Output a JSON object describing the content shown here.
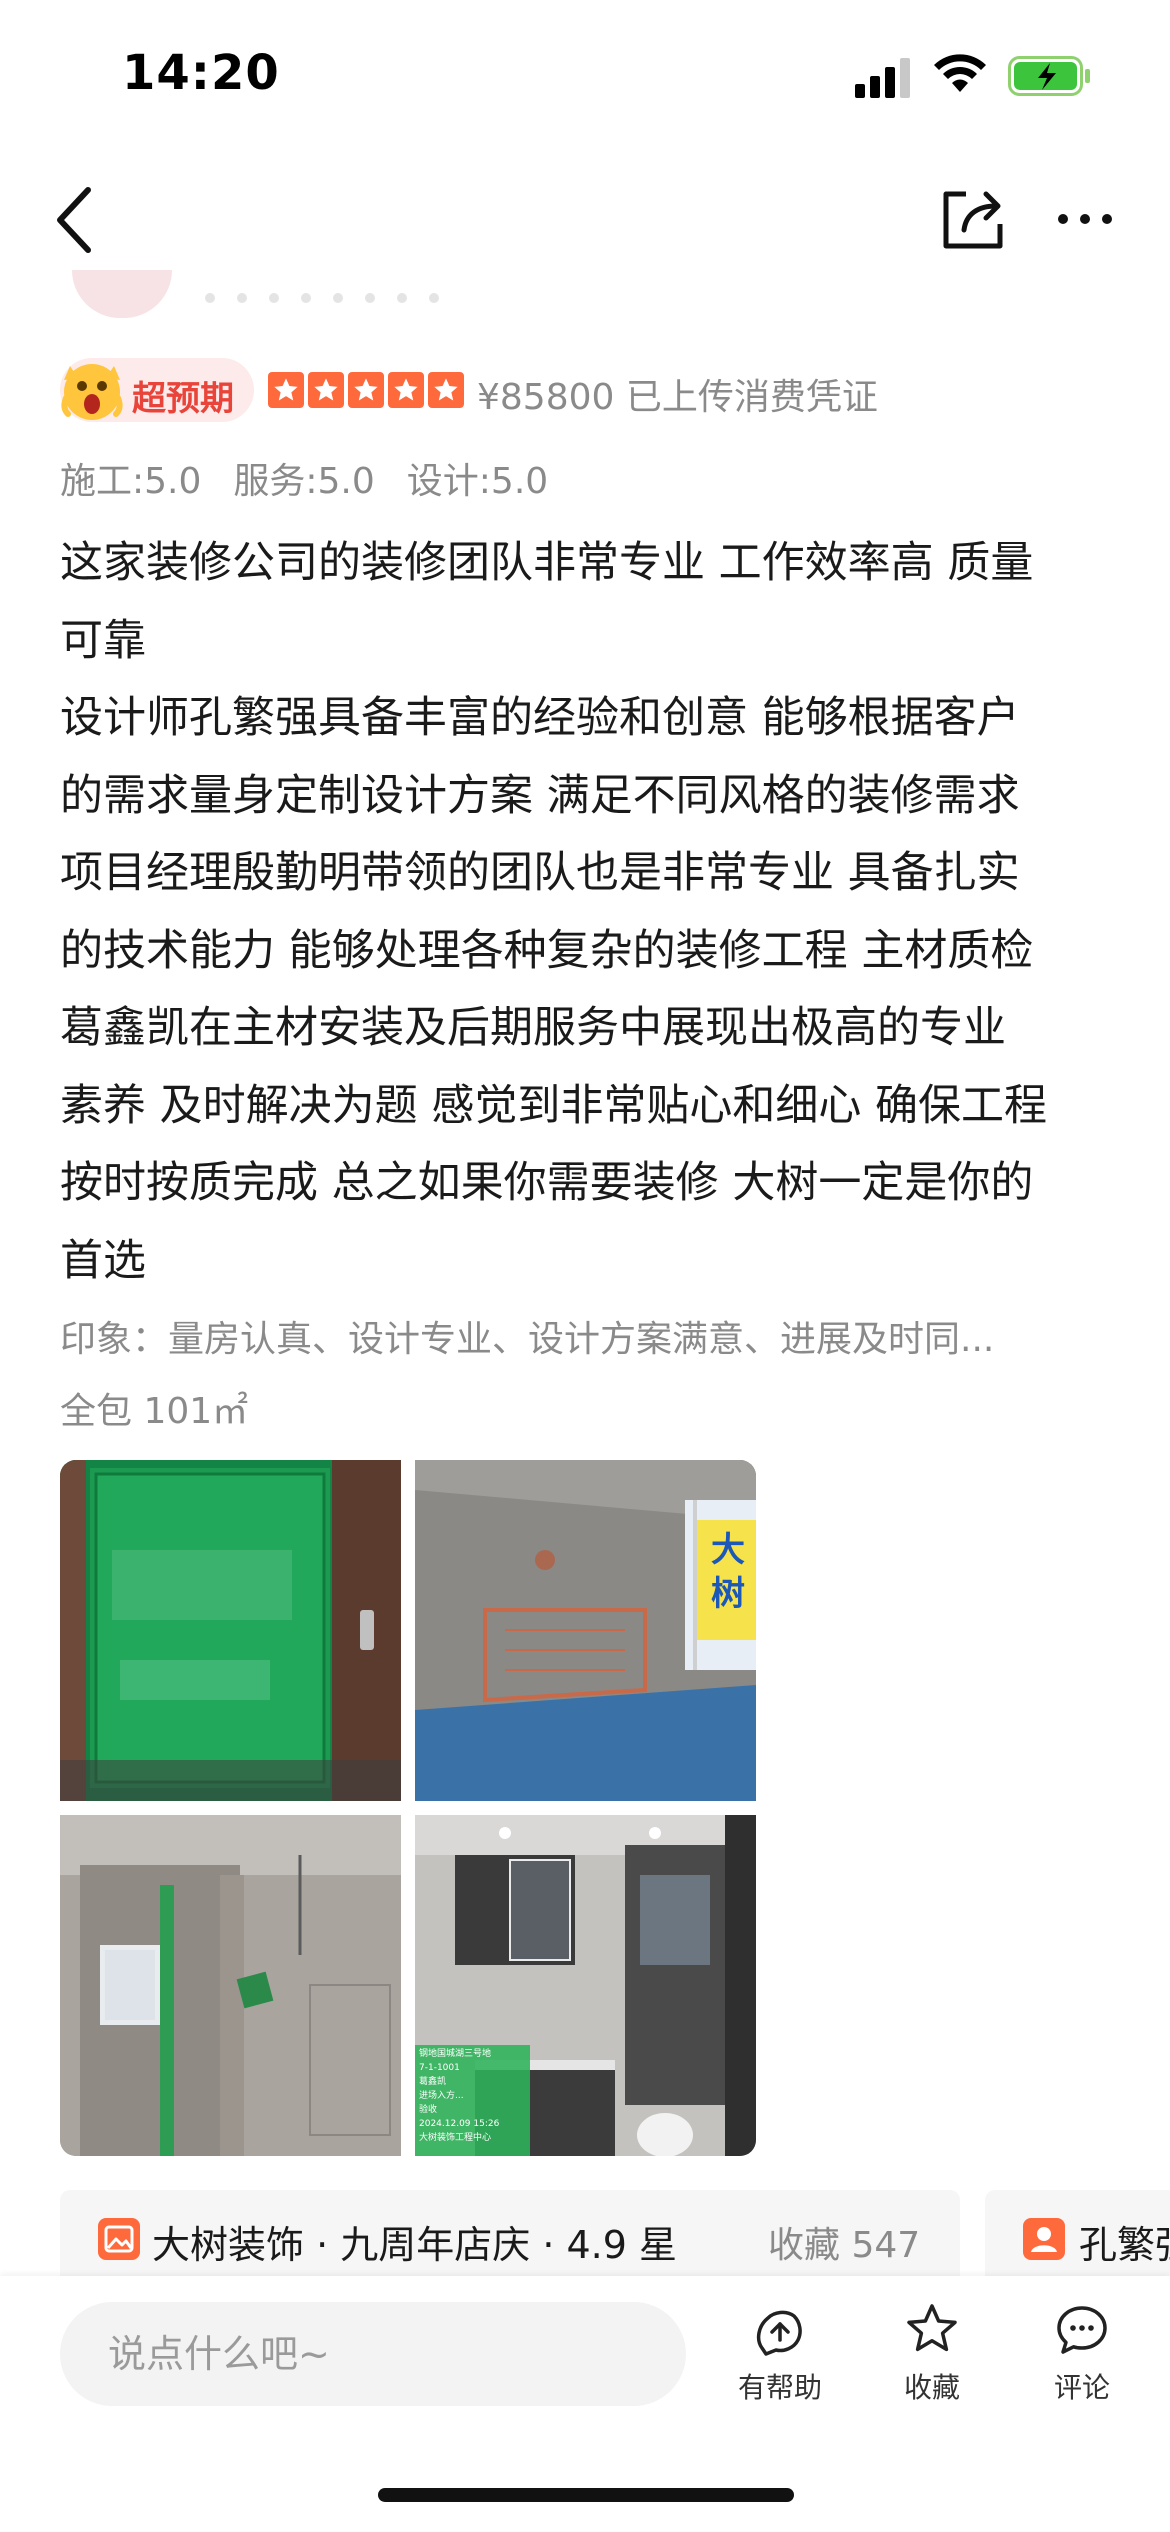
{
  "status_bar": {
    "time": "14:20"
  },
  "nav": {
    "back": "back",
    "share": "share",
    "more": "more"
  },
  "review": {
    "badge_label": "超预期",
    "stars": 5,
    "price_line": "¥85800 已上传消费凭证",
    "scores": [
      "施工:5.0",
      "服务:5.0",
      "设计:5.0"
    ],
    "lines": [
      "这家装修公司的装修团队非常专业 工作效率高  质量",
      "可靠",
      "设计师孔繁强具备丰富的经验和创意 能够根据客户",
      "的需求量身定制设计方案 满足不同风格的装修需求",
      "项目经理殷勤明带领的团队也是非常专业 具备扎实",
      "的技术能力 能够处理各种复杂的装修工程 主材质检",
      "葛鑫凯在主材安装及后期服务中展现出极高的专业",
      "素养 及时解决为题 感觉到非常贴心和细心 确保工程",
      "按时按质完成 总之如果你需要装修 大树一定是你的",
      "首选"
    ],
    "impression": "印象：量房认真、设计专业、设计方案满意、进展及时同...",
    "area": "全包 101㎡"
  },
  "photos": {
    "photo2_sign": "大树",
    "photo4_stamp": [
      "钢地国城湖三号地",
      "7-1-1001",
      "葛鑫凯",
      "进场入方...",
      "验收",
      "2024.12.09 15:26",
      "大树装饰工程中心"
    ]
  },
  "shop_card": {
    "name": "大树装饰 · 九周年店庆 · 4.9 星",
    "favorites": "收藏 547"
  },
  "designer_card": {
    "name": "孔繁强"
  },
  "bottom_bar": {
    "comment_placeholder": "说点什么吧~",
    "helpful_label": "有帮助",
    "favorite_label": "收藏",
    "comment_label": "评论"
  },
  "colors": {
    "accent": "#ff6a3d",
    "badge_text": "#e8443a",
    "muted_text": "#8a8a8a"
  }
}
